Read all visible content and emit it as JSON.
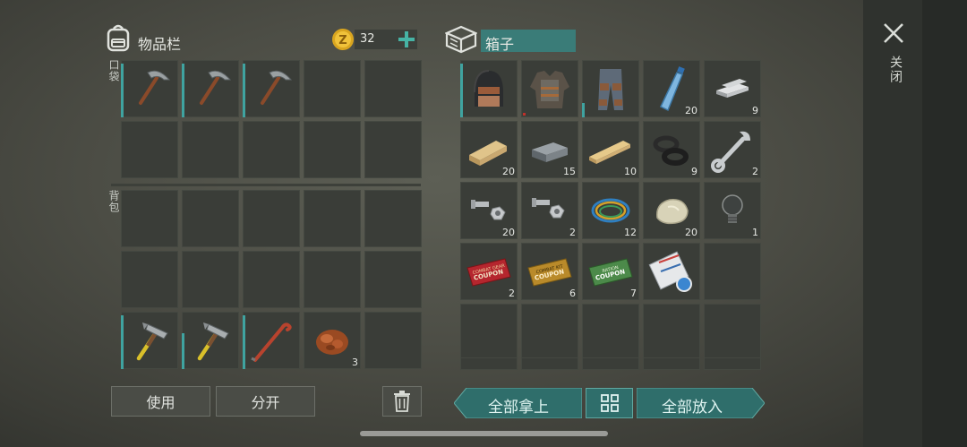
{
  "inventory": {
    "title": "物品栏",
    "coins": "32",
    "pocket_label": "口袋",
    "backpack_label": "背包",
    "pocket": [
      {
        "icon": "pickaxe-icon",
        "count": "",
        "dur": 60
      },
      {
        "icon": "pickaxe-icon",
        "count": "",
        "dur": 60
      },
      {
        "icon": "pickaxe-icon",
        "count": "",
        "dur": 60
      },
      {
        "icon": "",
        "count": "",
        "dur": 0
      },
      {
        "icon": "",
        "count": "",
        "dur": 0
      },
      {
        "icon": "",
        "count": "",
        "dur": 0
      },
      {
        "icon": "",
        "count": "",
        "dur": 0
      },
      {
        "icon": "",
        "count": "",
        "dur": 0
      },
      {
        "icon": "",
        "count": "",
        "dur": 0
      },
      {
        "icon": "",
        "count": "",
        "dur": 0
      }
    ],
    "backpack": [
      {
        "icon": "",
        "count": "",
        "dur": 0
      },
      {
        "icon": "",
        "count": "",
        "dur": 0
      },
      {
        "icon": "",
        "count": "",
        "dur": 0
      },
      {
        "icon": "",
        "count": "",
        "dur": 0
      },
      {
        "icon": "",
        "count": "",
        "dur": 0
      },
      {
        "icon": "",
        "count": "",
        "dur": 0
      },
      {
        "icon": "",
        "count": "",
        "dur": 0
      },
      {
        "icon": "",
        "count": "",
        "dur": 0
      },
      {
        "icon": "",
        "count": "",
        "dur": 0
      },
      {
        "icon": "",
        "count": "",
        "dur": 0
      },
      {
        "icon": "hammer-icon",
        "count": "",
        "dur": 60
      },
      {
        "icon": "hammer-icon",
        "count": "",
        "dur": 40
      },
      {
        "icon": "crowbar-icon",
        "count": "",
        "dur": 60
      },
      {
        "icon": "ore-icon",
        "count": "3",
        "dur": 0
      },
      {
        "icon": "",
        "count": "",
        "dur": 0
      }
    ]
  },
  "buttons": {
    "use": "使用",
    "split": "分开",
    "take_all": "全部拿上",
    "put_all": "全部放入",
    "close": "关闭"
  },
  "container": {
    "title": "箱子",
    "items": [
      {
        "icon": "helmet-icon",
        "count": "",
        "dur": 60
      },
      {
        "icon": "body-armor-icon",
        "count": "",
        "dur": 0,
        "red": true
      },
      {
        "icon": "armored-pants-icon",
        "count": "",
        "dur": 16
      },
      {
        "icon": "water-bottle-icon",
        "count": "20",
        "dur": 0
      },
      {
        "icon": "metal-bars-icon",
        "count": "9",
        "dur": 0
      },
      {
        "icon": "wood-plank-icon",
        "count": "20",
        "dur": 0
      },
      {
        "icon": "iron-ingot-icon",
        "count": "15",
        "dur": 0
      },
      {
        "icon": "board-icon",
        "count": "10",
        "dur": 0
      },
      {
        "icon": "rubber-seals-icon",
        "count": "9",
        "dur": 0
      },
      {
        "icon": "wrench-icon",
        "count": "2",
        "dur": 0
      },
      {
        "icon": "bolts-icon",
        "count": "20",
        "dur": 0
      },
      {
        "icon": "bolt-nut-icon",
        "count": "2",
        "dur": 0
      },
      {
        "icon": "wires-icon",
        "count": "12",
        "dur": 0
      },
      {
        "icon": "stone-icon",
        "count": "20",
        "dur": 0
      },
      {
        "icon": "light-bulb-icon",
        "count": "1",
        "dur": 0
      },
      {
        "icon": "coupon-red-icon",
        "count": "2",
        "dur": 0,
        "text": "COMBAT GEAR\nCOUPON"
      },
      {
        "icon": "coupon-gold-icon",
        "count": "6",
        "dur": 0,
        "text": "COMBAT KIT\nCOUPON"
      },
      {
        "icon": "coupon-green-icon",
        "count": "7",
        "dur": 0,
        "text": "RATION\nCOUPON"
      },
      {
        "icon": "blueprint-icon",
        "count": "",
        "dur": 0
      },
      {
        "icon": "",
        "count": "",
        "dur": 0
      },
      {
        "icon": "",
        "count": "",
        "dur": 0
      },
      {
        "icon": "",
        "count": "",
        "dur": 0
      },
      {
        "icon": "",
        "count": "",
        "dur": 0
      },
      {
        "icon": "",
        "count": "",
        "dur": 0
      },
      {
        "icon": "",
        "count": "",
        "dur": 0
      }
    ]
  }
}
